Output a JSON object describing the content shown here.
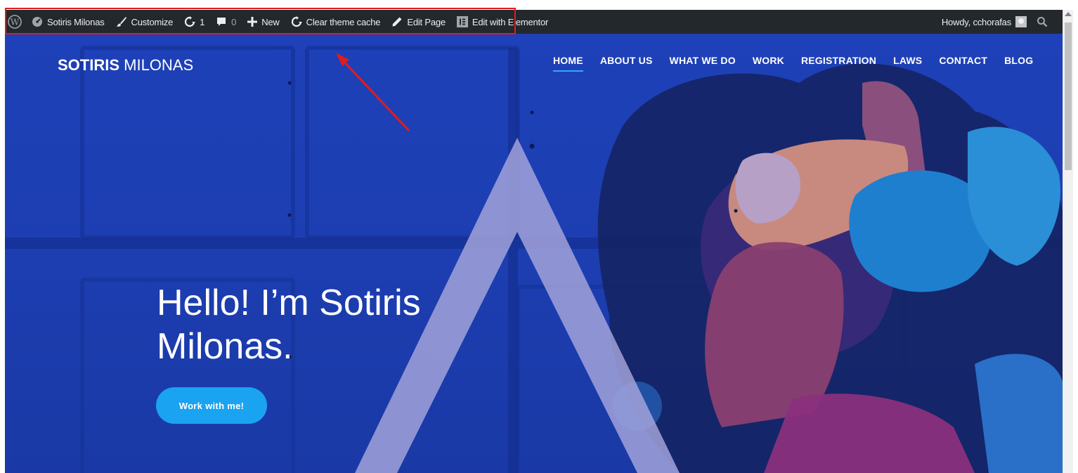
{
  "adminbar": {
    "items": [
      {
        "label": "",
        "icon": "wordpress-logo-icon"
      },
      {
        "label": "Sotiris Milonas",
        "icon": "dashboard-icon"
      },
      {
        "label": "Customize",
        "icon": "brush-icon"
      },
      {
        "label": "1",
        "icon": "updates-icon"
      },
      {
        "label": "0",
        "icon": "comments-icon"
      },
      {
        "label": "New",
        "icon": "plus-icon"
      },
      {
        "label": "Clear theme cache",
        "icon": "refresh-icon"
      },
      {
        "label": "Edit Page",
        "icon": "pencil-icon"
      },
      {
        "label": "Edit with Elementor",
        "icon": "elementor-icon"
      }
    ],
    "howdy": "Howdy, cchorafas",
    "search_icon": "search-icon"
  },
  "site": {
    "logo_bold": "SOTIRIS",
    "logo_light": " MILONAS",
    "nav": [
      "HOME",
      "ABOUT US",
      "WHAT WE DO",
      "WORK",
      "REGISTRATION",
      "LAWS",
      "CONTACT",
      "BLOG"
    ],
    "active_nav": "HOME"
  },
  "hero": {
    "line1": "Hello! I’m Sotiris",
    "line2": "Milonas.",
    "cta": "Work with me!"
  },
  "colors": {
    "adminbar": "#23282d",
    "highlight": "#e21b1b",
    "hero_blue": "#1e40b8",
    "accent": "#1aa3f0"
  }
}
